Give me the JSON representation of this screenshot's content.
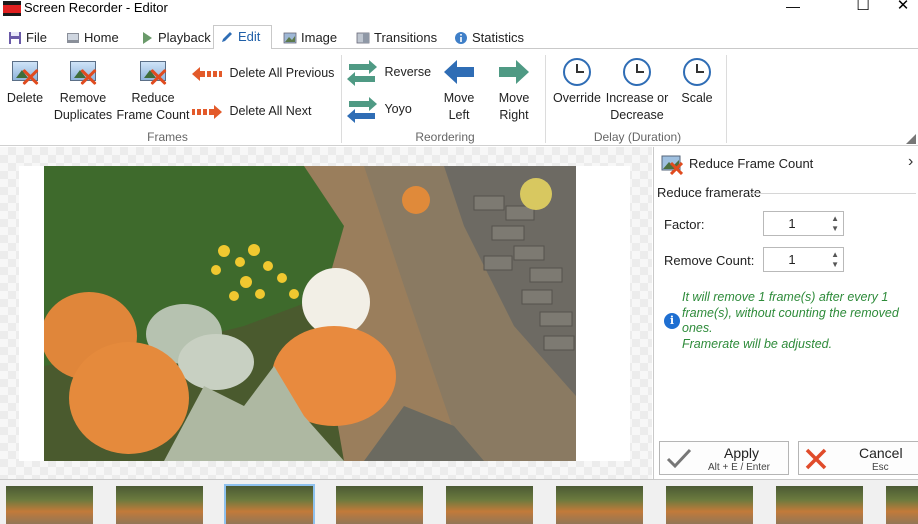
{
  "window": {
    "title": "Screen Recorder - Editor",
    "minimize": "—",
    "maximize": "☐",
    "close": "✕"
  },
  "tabs": [
    {
      "label": "File",
      "icon": "save-icon"
    },
    {
      "label": "Home",
      "icon": "home-icon"
    },
    {
      "label": "Playback",
      "icon": "play-icon"
    },
    {
      "label": "Edit",
      "icon": "pencil-icon",
      "active": true
    },
    {
      "label": "Image",
      "icon": "image-icon"
    },
    {
      "label": "Transitions",
      "icon": "transitions-icon"
    },
    {
      "label": "Statistics",
      "icon": "info-icon"
    }
  ],
  "ribbon": {
    "frames": {
      "group_label": "Frames",
      "delete": "Delete",
      "remove_duplicates_1": "Remove",
      "remove_duplicates_2": "Duplicates",
      "reduce_1": "Reduce",
      "reduce_2": "Frame Count",
      "delete_all_previous": "Delete All Previous",
      "delete_all_next": "Delete All Next"
    },
    "reordering": {
      "group_label": "Reordering",
      "reverse": "Reverse",
      "yoyo": "Yoyo",
      "move_left_1": "Move",
      "move_left_2": "Left",
      "move_right_1": "Move",
      "move_right_2": "Right"
    },
    "delay": {
      "group_label": "Delay (Duration)",
      "override": "Override",
      "increase_1": "Increase or",
      "increase_2": "Decrease",
      "scale": "Scale"
    }
  },
  "panel": {
    "title": "Reduce Frame Count",
    "section": "Reduce framerate",
    "factor_label": "Factor:",
    "factor_value": "1",
    "remove_label": "Remove Count:",
    "remove_value": "1",
    "info_line1": "It will remove 1 frame(s) after every 1",
    "info_line2": "frame(s), without counting the removed",
    "info_line3": "ones.",
    "info_line4": "Framerate will be adjusted.",
    "apply_label": "Apply",
    "apply_shortcut": "Alt + E / Enter",
    "cancel_label": "Cancel",
    "cancel_shortcut": "Esc"
  },
  "colors": {
    "accent": "#1f5fa8",
    "info_text": "#2e8b3a",
    "apply_check": "#777777",
    "cancel_x": "#e04b2a"
  }
}
